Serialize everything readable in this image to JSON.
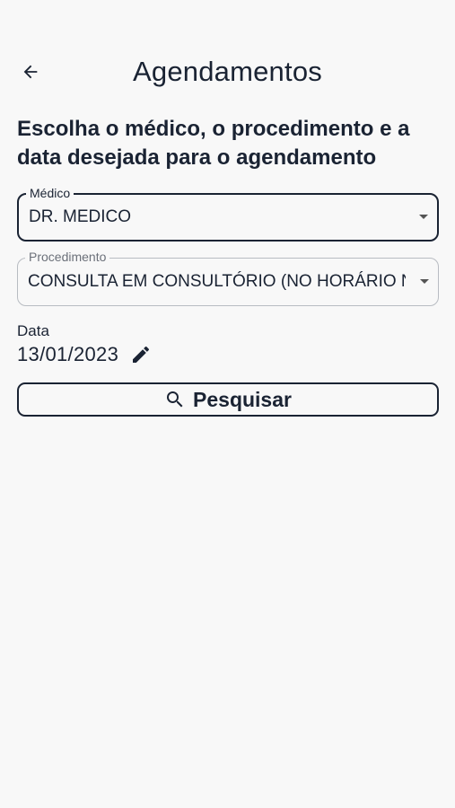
{
  "header": {
    "title": "Agendamentos",
    "back_icon": "arrow-left-icon"
  },
  "instruction": "Escolha o médico, o procedimento e a data desejada para o agendamento",
  "form": {
    "medico": {
      "label": "Médico",
      "value": "DR. MEDICO"
    },
    "procedimento": {
      "label": "Procedimento",
      "value": "CONSULTA EM CONSULTÓRIO (NO HORÁRIO NORMAL OU PREESTABELECIDO)"
    },
    "data": {
      "label": "Data",
      "value": "13/01/2023",
      "edit_icon": "pencil-icon"
    },
    "search_button": {
      "label": "Pesquisar",
      "icon": "search-icon"
    }
  },
  "colors": {
    "primary": "#1a2333",
    "background": "#f8f8f8",
    "border_inactive": "#b8bcc2"
  }
}
